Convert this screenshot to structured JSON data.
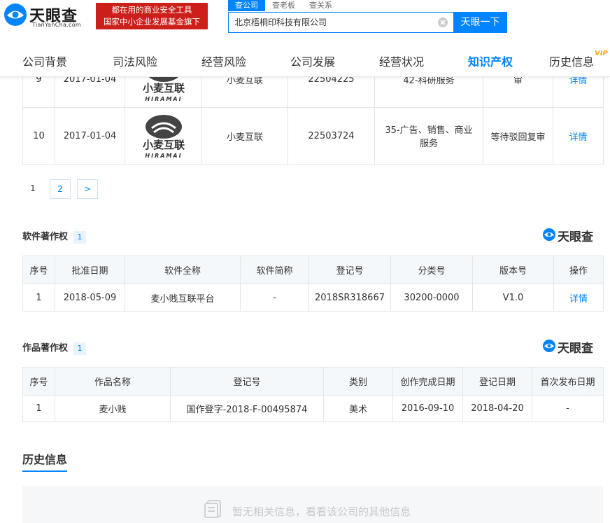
{
  "header": {
    "logo_text": "天眼查",
    "logo_sub": "TianYanCha.com",
    "promo_line1": "都在用的商业安全工具",
    "promo_line2": "国家中小企业发展基金旗下",
    "search_tabs": [
      "查公司",
      "查老板",
      "查关系"
    ],
    "search_value": "北京梧桐印科技有限公司",
    "search_button": "天眼一下"
  },
  "nav": {
    "items": [
      "公司背景",
      "司法风险",
      "经营风险",
      "公司发展",
      "经营状况",
      "知识产权",
      "历史信息"
    ],
    "active": "知识产权",
    "vip": "VIP"
  },
  "trademarks": {
    "rows": [
      {
        "no": "9",
        "date": "2017-01-04",
        "logo_text": "小麦互联",
        "logo_sub": "HIRAMAI",
        "name": "小麦互联",
        "reg": "22504225",
        "class": "42-科研服务",
        "status": "审",
        "action": "详情"
      },
      {
        "no": "10",
        "date": "2017-01-04",
        "logo_text": "小麦互联",
        "logo_sub": "HIRAMAI",
        "name": "小麦互联",
        "reg": "22503724",
        "class": "35-广告、销售、商业服务",
        "status": "等待驳回复审",
        "action": "详情"
      }
    ]
  },
  "pager": {
    "current": "1",
    "next_page": "2",
    "next": ">"
  },
  "watermark": "天眼查",
  "software": {
    "title": "软件著作权",
    "count": "1",
    "headers": [
      "序号",
      "批准日期",
      "软件全称",
      "软件简称",
      "登记号",
      "分类号",
      "版本号",
      "操作"
    ],
    "rows": [
      {
        "no": "1",
        "date": "2018-05-09",
        "full": "麦小贱互联平台",
        "short": "-",
        "reg": "2018SR318667",
        "class": "30200-0000",
        "version": "V1.0",
        "action": "详情"
      }
    ]
  },
  "works": {
    "title": "作品著作权",
    "count": "1",
    "headers": [
      "序号",
      "作品名称",
      "登记号",
      "类别",
      "创作完成日期",
      "登记日期",
      "首次发布日期"
    ],
    "rows": [
      {
        "no": "1",
        "name": "麦小贱",
        "reg": "国作登字-2018-F-00495874",
        "type": "美术",
        "done": "2016-09-10",
        "regdate": "2018-04-20",
        "first": "-"
      }
    ]
  },
  "history": {
    "title": "历史信息",
    "empty_text": "暂无相关信息，看看该公司的其他信息"
  },
  "colors": {
    "accent": "#0084ff",
    "promo": "#cc1f1a",
    "header_bg": "#f5f8fa"
  }
}
